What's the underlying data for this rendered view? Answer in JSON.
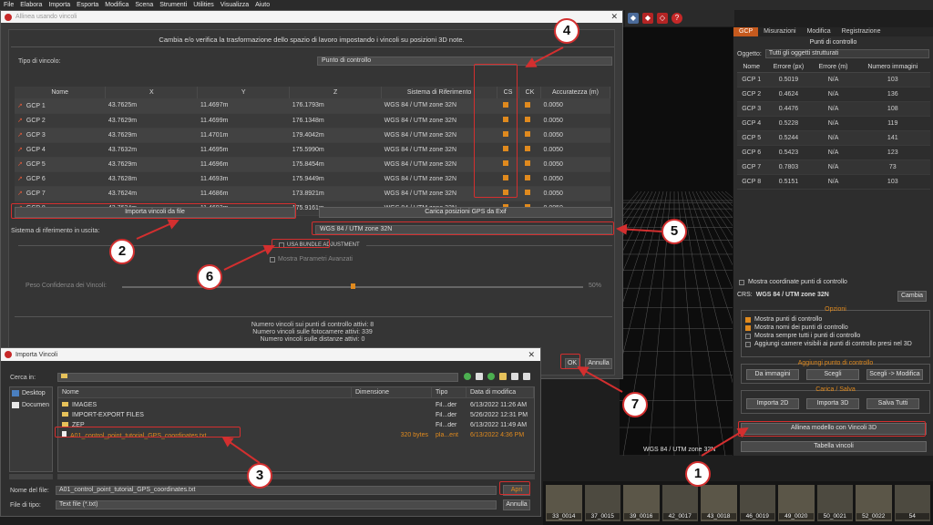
{
  "menu": [
    "File",
    "Elabora",
    "Importa",
    "Esporta",
    "Modifica",
    "Scena",
    "Strumenti",
    "Utilities",
    "Visualizza",
    "Aiuto"
  ],
  "dialog": {
    "title": "Allinea usando vincoli",
    "header": "Cambia e/o verifica la trasformazione dello spazio di lavoro impostando i vincoli su posizioni 3D note.",
    "constraint_type_label": "Tipo di vincolo:",
    "constraint_type_value": "Punto di controllo",
    "columns": [
      "Nome",
      "X",
      "Y",
      "Z",
      "Sistema di Riferimento",
      "CS",
      "CK",
      "Accuratezza (m)"
    ],
    "rows": [
      {
        "name": "GCP 1",
        "x": "43.7625m",
        "y": "11.4697m",
        "z": "176.1793m",
        "crs": "WGS 84 / UTM zone 32N",
        "acc": "0.0050"
      },
      {
        "name": "GCP 2",
        "x": "43.7629m",
        "y": "11.4699m",
        "z": "176.1348m",
        "crs": "WGS 84 / UTM zone 32N",
        "acc": "0.0050"
      },
      {
        "name": "GCP 3",
        "x": "43.7629m",
        "y": "11.4701m",
        "z": "179.4042m",
        "crs": "WGS 84 / UTM zone 32N",
        "acc": "0.0050"
      },
      {
        "name": "GCP 4",
        "x": "43.7632m",
        "y": "11.4695m",
        "z": "175.5990m",
        "crs": "WGS 84 / UTM zone 32N",
        "acc": "0.0050"
      },
      {
        "name": "GCP 5",
        "x": "43.7629m",
        "y": "11.4696m",
        "z": "175.8454m",
        "crs": "WGS 84 / UTM zone 32N",
        "acc": "0.0050"
      },
      {
        "name": "GCP 6",
        "x": "43.7628m",
        "y": "11.4693m",
        "z": "175.9449m",
        "crs": "WGS 84 / UTM zone 32N",
        "acc": "0.0050"
      },
      {
        "name": "GCP 7",
        "x": "43.7624m",
        "y": "11.4686m",
        "z": "173.8921m",
        "crs": "WGS 84 / UTM zone 32N",
        "acc": "0.0050"
      },
      {
        "name": "GCP 8",
        "x": "43.7624m",
        "y": "11.4693m",
        "z": "175.9161m",
        "crs": "WGS 84 / UTM zone 32N",
        "acc": "0.0050"
      }
    ],
    "import_button": "Importa vincoli da file",
    "gps_button": "Carica posizioni GPS da Exif",
    "output_crs_label": "Sistema di riferimento in uscita:",
    "output_crs_value": "WGS 84 / UTM zone 32N",
    "bundle_label": "USA BUNDLE ADJUSTMENT",
    "advanced_label": "Mostra Parametri Avanzati",
    "weight_label": "Peso Confidenza dei Vincoli:",
    "weight_value": "50%",
    "weight_fraction": 0.5,
    "summary": [
      "Numero vincoli sui punti di controllo attivi: 8",
      "Numero vincoli sulle fotocamere attivi: 339",
      "Numero vincoli sulle distanze attivi: 0"
    ],
    "ok": "OK",
    "cancel": "Annulla"
  },
  "import_dialog": {
    "title": "Importa Vincoli",
    "look_in_label": "Cerca in:",
    "places": [
      "Desktop",
      "Documen"
    ],
    "columns": [
      "Nome",
      "Dimensione",
      "Tipo",
      "Data di modifica"
    ],
    "files": [
      {
        "name": "IMAGES",
        "size": "",
        "type": "Fil...der",
        "date": "6/13/2022 11:26 AM",
        "kind": "folder"
      },
      {
        "name": "IMPORT-EXPORT FILES",
        "size": "",
        "type": "Fil...der",
        "date": "5/26/2022 12:31 PM",
        "kind": "folder"
      },
      {
        "name": "ZEP",
        "size": "",
        "type": "Fil...der",
        "date": "6/13/2022 11:49 AM",
        "kind": "folder"
      },
      {
        "name": "A01_control_point_tutorial_GPS_coordinates.txt",
        "size": "320 bytes",
        "type": "pla...ent",
        "date": "6/13/2022 4:36 PM",
        "kind": "file"
      }
    ],
    "filename_label": "Nome del file:",
    "filename_value": "A01_control_point_tutorial_GPS_coordinates.txt",
    "filetype_label": "File di tipo:",
    "filetype_value": "Text file (*.txt)",
    "open": "Apri",
    "cancel": "Annulla"
  },
  "right_panel": {
    "tabs": [
      "GCP",
      "Misurazioni",
      "Modifica",
      "Registrazione"
    ],
    "title": "Punti di controllo",
    "object_label": "Oggetto:",
    "object_value": "Tutti gli oggetti strutturati",
    "columns": [
      "Nome",
      "Errore (px)",
      "Errore (m)",
      "Numero immagini"
    ],
    "rows": [
      {
        "name": "GCP 1",
        "err_px": "0.5019",
        "err_m": "N/A",
        "n": "103"
      },
      {
        "name": "GCP 2",
        "err_px": "0.4624",
        "err_m": "N/A",
        "n": "136"
      },
      {
        "name": "GCP 3",
        "err_px": "0.4476",
        "err_m": "N/A",
        "n": "108"
      },
      {
        "name": "GCP 4",
        "err_px": "0.5228",
        "err_m": "N/A",
        "n": "119"
      },
      {
        "name": "GCP 5",
        "err_px": "0.5244",
        "err_m": "N/A",
        "n": "141"
      },
      {
        "name": "GCP 6",
        "err_px": "0.5423",
        "err_m": "N/A",
        "n": "123"
      },
      {
        "name": "GCP 7",
        "err_px": "0.7803",
        "err_m": "N/A",
        "n": "73"
      },
      {
        "name": "GCP 8",
        "err_px": "0.5151",
        "err_m": "N/A",
        "n": "103"
      }
    ],
    "show_coords": "Mostra coordinate punti di controllo",
    "crs_label": "CRS:",
    "crs_value": "WGS 84 / UTM zone 32N",
    "crs_change": "Cambia",
    "options_title": "Opzioni",
    "options": [
      {
        "label": "Mostra punti di controllo",
        "on": true
      },
      {
        "label": "Mostra nomi dei punti di controllo",
        "on": true
      },
      {
        "label": "Mostra sempre tutti i punti di controllo",
        "on": false
      },
      {
        "label": "Aggiungi camere visibili ai punti di controllo presi nel 3D",
        "on": false
      }
    ],
    "add_title": "Aggiungi punto di controllo",
    "add_buttons": [
      "Da immagini",
      "Scegli",
      "Scegli -> Modifica"
    ],
    "load_title": "Carica / Salva",
    "load_buttons": [
      "Importa 2D",
      "Importa 3D",
      "Salva Tutti"
    ],
    "align_button": "Allinea modello con Vincoli 3D",
    "table_button": "Tabella vincoli"
  },
  "viewport_crs": "WGS 84 / UTM zone 32N",
  "filmstrip": [
    "33_0014",
    "37_0015",
    "39_0016",
    "42_0017",
    "43_0018",
    "46_0019",
    "49_0020",
    "50_0021",
    "52_0022",
    "54"
  ],
  "callouts": [
    "1",
    "2",
    "3",
    "4",
    "5",
    "6",
    "7"
  ],
  "colors": {
    "accent": "#e08a1e",
    "highlight": "#d32f2f",
    "tab_active": "#c65a1e"
  }
}
